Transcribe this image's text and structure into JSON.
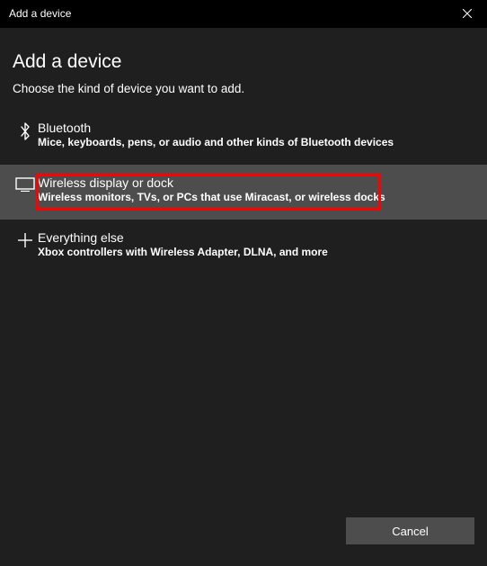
{
  "window": {
    "title": "Add a device"
  },
  "header": {
    "heading": "Add a device",
    "prompt": "Choose the kind of device you want to add."
  },
  "options": [
    {
      "label": "Bluetooth",
      "desc": "Mice, keyboards, pens, or audio and other kinds of Bluetooth devices"
    },
    {
      "label": "Wireless display or dock",
      "desc": "Wireless monitors, TVs, or PCs that use Miracast, or wireless docks"
    },
    {
      "label": "Everything else",
      "desc": "Xbox controllers with Wireless Adapter, DLNA, and more"
    }
  ],
  "selected_index": 1,
  "buttons": {
    "cancel": "Cancel"
  }
}
